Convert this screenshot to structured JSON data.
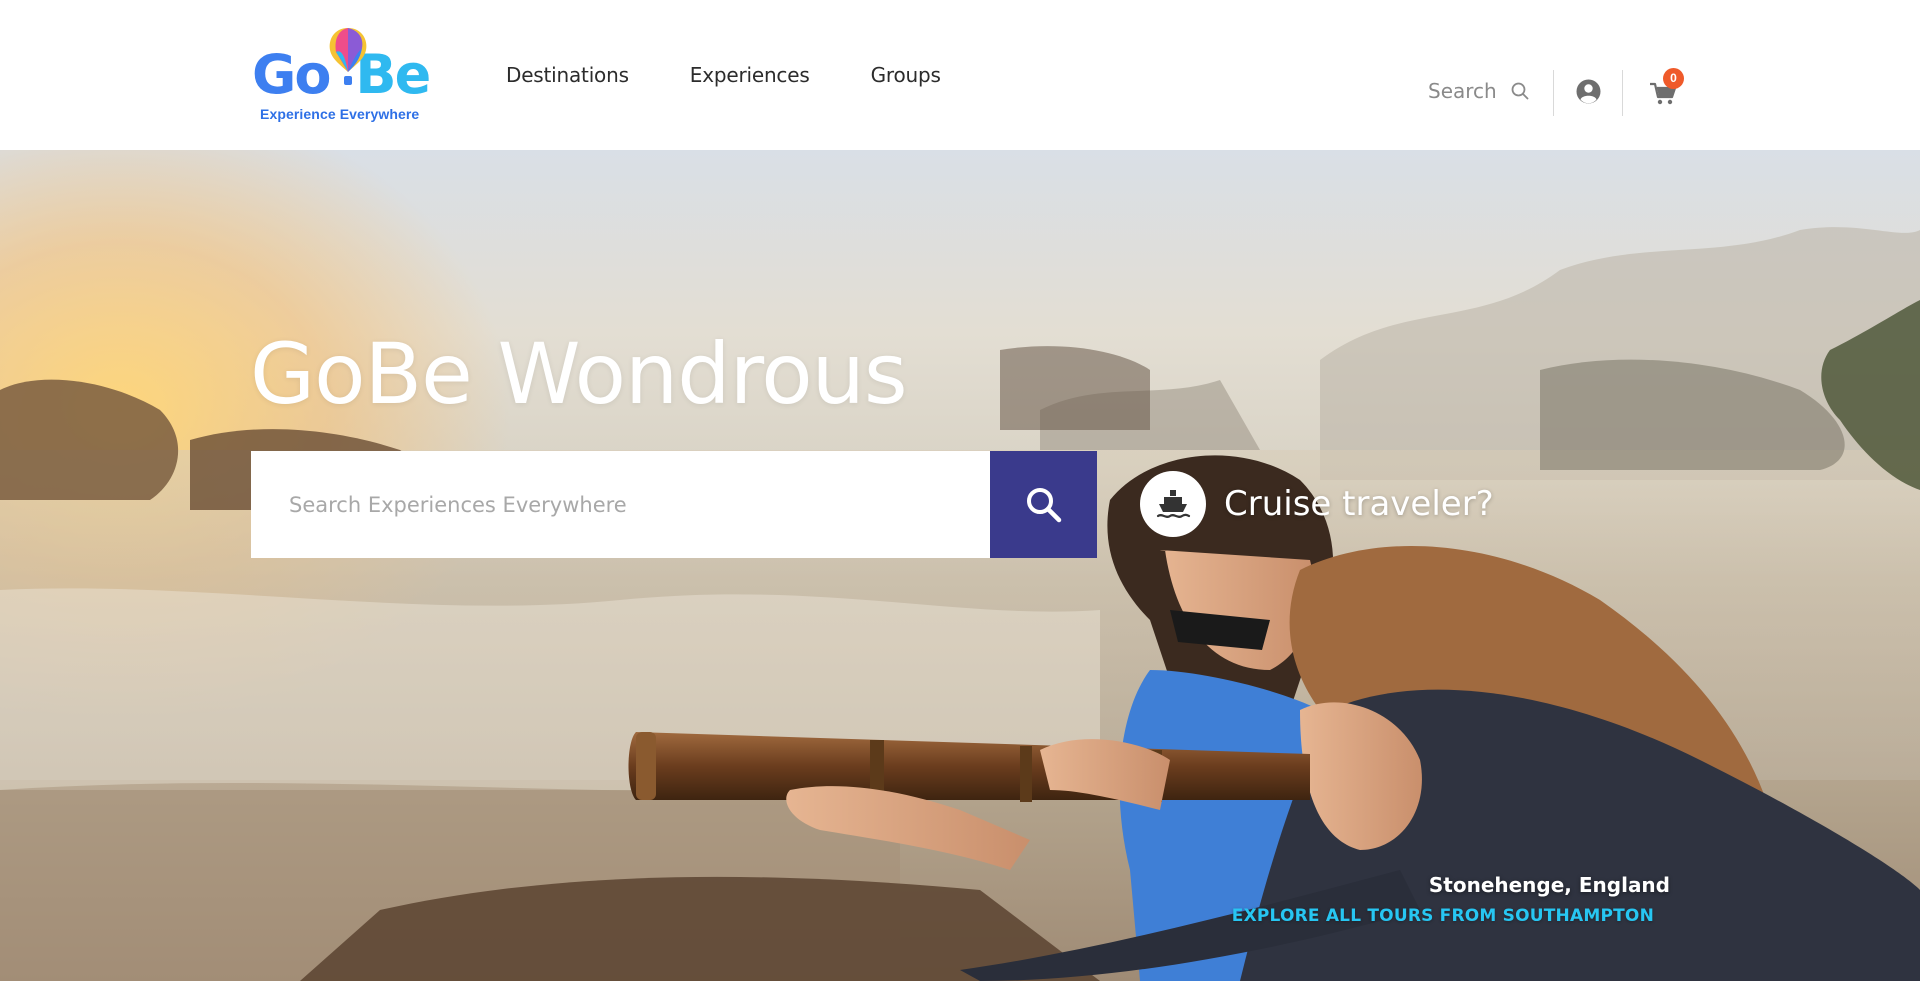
{
  "brand": {
    "tagline": "Experience Everywhere",
    "go": "Go",
    "be": "Be",
    "colors": {
      "go": "#3d7ff0",
      "be": "#2fb9f0",
      "tagline": "#2e70e6"
    }
  },
  "nav": {
    "items": [
      {
        "label": "Destinations"
      },
      {
        "label": "Experiences"
      },
      {
        "label": "Groups"
      }
    ]
  },
  "header": {
    "search_label": "Search",
    "search_icon": "search-icon",
    "account_icon": "user-circle-icon",
    "cart_icon": "cart-icon",
    "cart_count": "0",
    "cart_badge_color": "#ef5a2a"
  },
  "hero": {
    "title": "GoBe Wondrous",
    "search_placeholder": "Search Experiences Everywhere",
    "search_button_color": "#3a3a8c",
    "cruise_label": "Cruise traveler?",
    "cruise_icon": "ship-icon",
    "location": "Stonehenge, England",
    "explore_link": "EXPLORE ALL TOURS FROM SOUTHAMPTON",
    "explore_color": "#27c6f2"
  }
}
